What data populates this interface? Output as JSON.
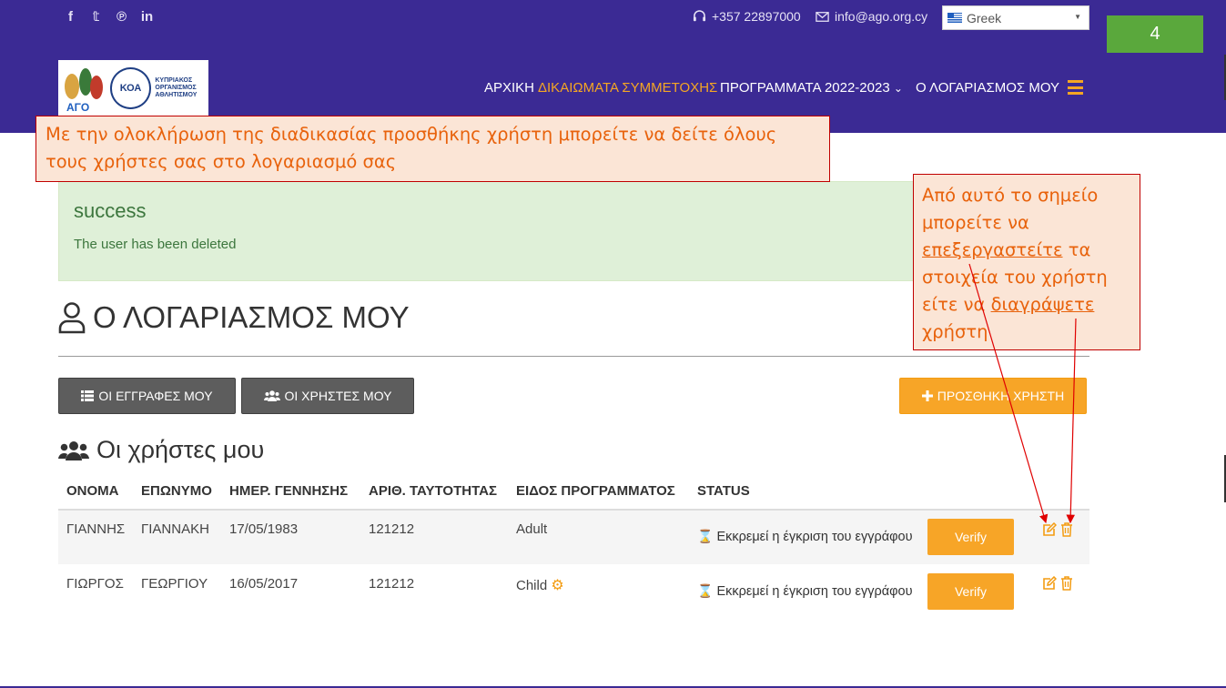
{
  "topbar": {
    "social_icons": [
      "facebook-icon",
      "twitter-icon",
      "pinterest-icon",
      "linkedin-icon"
    ],
    "social_glyphs": [
      "f",
      "𝕥",
      "℗",
      "in"
    ],
    "phone": "+357 22897000",
    "email": "info@ago.org.cy",
    "language": "Greek",
    "slide_number": "4"
  },
  "nav": {
    "items": [
      {
        "label": "ΑΡΧΙΚΗ"
      },
      {
        "label": "ΔΙΚΑΙΩΜΑΤΑ ΣΥΜΜΕΤΟΧΗΣ"
      },
      {
        "label": "ΠΡΟΓΡΑΜΜΑΤΑ 2022-2023"
      },
      {
        "label": "Ο ΛΟΓΑΡΙΑΣΜΟΣ ΜΟΥ"
      }
    ],
    "dropdown_caret": "⌄"
  },
  "logo": {
    "text_lines": [
      "ΚΥΠΡΙΑΚΟΣ",
      "ΟΡΓΑΝΙΣΜΟΣ",
      "ΑΘΛΗΤΙΣΜΟΥ"
    ],
    "emblem": "ΚΟΑ"
  },
  "callouts": {
    "top": "Με την ολοκλήρωση της διαδικασίας προσθήκης χρήστη μπορείτε να δείτε όλους τους χρήστες σας στο λογαριασμό σας",
    "right_part1": "Από αυτό το σημείο μπορείτε να ",
    "right_edit": "επεξεργαστείτε",
    "right_part2": " τα στοιχεία του χρήστη είτε να ",
    "right_delete": "διαγράψετε",
    "right_part3": " χρήστη"
  },
  "alert": {
    "title": "success",
    "message": "The user has been deleted"
  },
  "page": {
    "title": "Ο ΛΟΓΑΡΙΑΣΜΟΣ ΜΟΥ",
    "btn_registrations": "ΟΙ ΕΓΓΡΑΦΕΣ ΜΟΥ",
    "btn_users": "ΟΙ ΧΡΗΣΤΕΣ ΜΟΥ",
    "btn_add_user": "ΠΡΟΣΘΗΚΗ ΧΡΗΣΤΗ",
    "section_title": "Οι χρήστες μου"
  },
  "table": {
    "headers": [
      "ΟΝΟΜΑ",
      "ΕΠΩΝΥΜΟ",
      "ΗΜΕΡ. ΓΕΝΝΗΣΗΣ",
      "ΑΡΙΘ. ΤΑΥΤΟΤΗΤΑΣ",
      "ΕΙΔΟΣ ΠΡΟΓΡΑΜΜΑΤΟΣ",
      "STATUS"
    ],
    "rows": [
      {
        "first": "ΓΙΑΝΝΗΣ",
        "last": "ΓΙΑΝΝΑΚΗ",
        "dob": "17/05/1983",
        "id": "121212",
        "program": "Adult",
        "status": "Εκκρεμεί η έγκριση του εγγράφου",
        "verify": "Verify"
      },
      {
        "first": "ΓΙΩΡΓΟΣ",
        "last": "ΓΕΩΡΓΙΟΥ",
        "dob": "16/05/2017",
        "id": "121212",
        "program": "Child",
        "status": "Εκκρεμεί η έγκριση του εγγράφου",
        "verify": "Verify"
      }
    ]
  },
  "colors": {
    "header_bg": "#3b2a94",
    "accent": "#f7a527",
    "callout_text": "#e8620c",
    "callout_border": "#c00000",
    "success_bg": "#dff0d8"
  }
}
